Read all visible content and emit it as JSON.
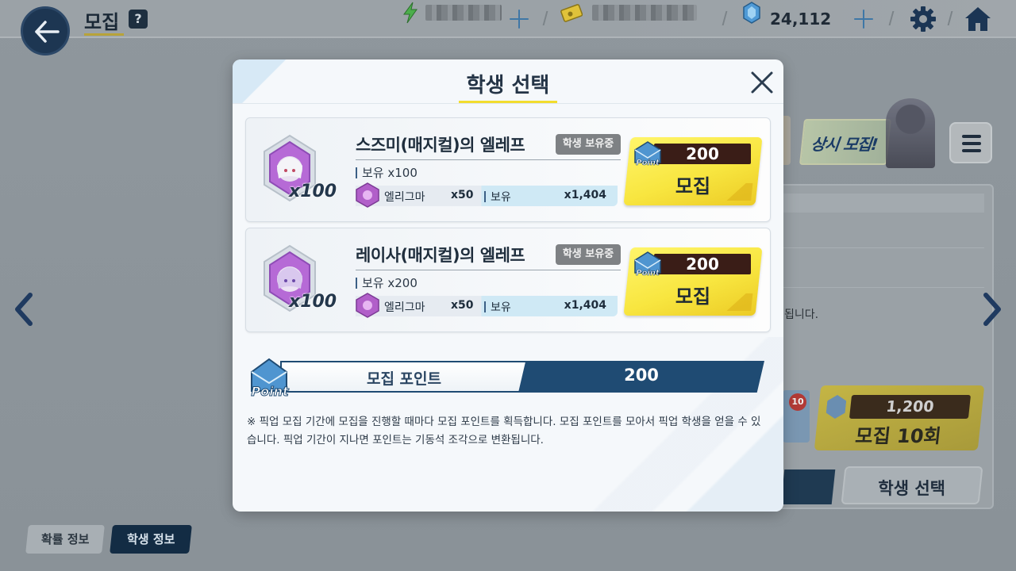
{
  "topbar": {
    "title": "모집",
    "help_label": "?",
    "gem_count": "24,112"
  },
  "background": {
    "banner_text": "상시 모집!",
    "notice_text": "됩니다.",
    "recruit10": {
      "cost": "1,200",
      "label": "모집 10회",
      "badge": "10"
    },
    "select_student_label": "학생 선택"
  },
  "bottom_tabs": [
    {
      "label": "확률 정보",
      "active": false
    },
    {
      "label": "학생 정보",
      "active": true
    }
  ],
  "modal": {
    "title": "학생 선택",
    "cards": [
      {
        "name": "스즈미(매지컬)의 엘레프",
        "badge": "학생 보유중",
        "portrait_count": "x100",
        "hold_label": "보유 x100",
        "eligma_name": "엘리그마",
        "eligma_cost": "x50",
        "eligma_hold_label": "보유",
        "eligma_hold": "x1,404",
        "recruit_cost": "200",
        "recruit_label": "모집"
      },
      {
        "name": "레이사(매지컬)의 엘레프",
        "badge": "학생 보유중",
        "portrait_count": "x100",
        "hold_label": "보유 x200",
        "eligma_name": "엘리그마",
        "eligma_cost": "x50",
        "eligma_hold_label": "보유",
        "eligma_hold": "x1,404",
        "recruit_cost": "200",
        "recruit_label": "모집"
      }
    ],
    "point_bar": {
      "badge_text": "Point",
      "label": "모집 포인트",
      "value": "200"
    },
    "note": "※ 픽업 모집 기간에 모집을 진행할 때마다 모집 포인트를 획득합니다. 모집 포인트를 모아서 픽업 학생을 얻을 수 있습니다. 픽업 기간이 지나면 포인트는 기동석 조각으로 변환됩니다."
  },
  "icons": {
    "back": "arrow-left-icon",
    "ap": "lightning-icon",
    "credit": "credit-card-icon",
    "gem": "pyroxene-gem-icon",
    "settings": "gear-icon",
    "home": "home-icon",
    "close": "close-icon"
  },
  "colors": {
    "navy": "#1f4b73",
    "yellow": "#f8e640",
    "accent_blue": "#3f77a6"
  }
}
